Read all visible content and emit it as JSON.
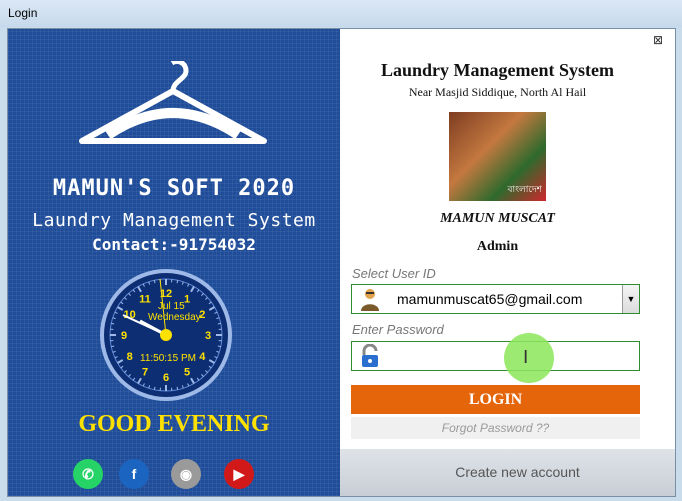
{
  "window": {
    "title": "Login"
  },
  "left_panel": {
    "brand_name": "MAMUN'S SOFT 2020",
    "brand_subtitle": "Laundry Management System",
    "contact": "Contact:-91754032",
    "clock": {
      "numbers": [
        "12",
        "1",
        "2",
        "3",
        "4",
        "5",
        "6",
        "7",
        "8",
        "9",
        "10",
        "11"
      ],
      "date": "Jul 15",
      "day": "Wednesday",
      "time": "11:50:15 PM"
    },
    "greeting": "GOOD EVENING",
    "social": [
      {
        "name": "whatsapp-icon",
        "glyph": "✆",
        "color": "#25d366"
      },
      {
        "name": "facebook-icon",
        "glyph": "f",
        "color": "#1b64c0"
      },
      {
        "name": "camera-icon",
        "glyph": "◉",
        "color": "#9a9a9a"
      },
      {
        "name": "youtube-icon",
        "glyph": "▶",
        "color": "#d11919"
      }
    ]
  },
  "right_panel": {
    "app_title": "Laundry Management System",
    "address": "Near Masjid Siddique, North Al Hail",
    "user_display_name": "MAMUN  MUSCAT",
    "role": "Admin",
    "user_id_label": "Select User  ID",
    "user_id_value": "mamunmuscat65@gmail.com",
    "password_label": "Enter Password",
    "password_value": "",
    "login_label": "LOGIN",
    "forgot_label": "Forgot Password ??",
    "create_account_label": "Create new account",
    "photo_caption": "বাংলাদেশ"
  },
  "colors": {
    "left_bg": "#1f4d99",
    "greeting": "#ffe100",
    "login_button": "#e5650b",
    "field_border": "#2e8b2e"
  }
}
